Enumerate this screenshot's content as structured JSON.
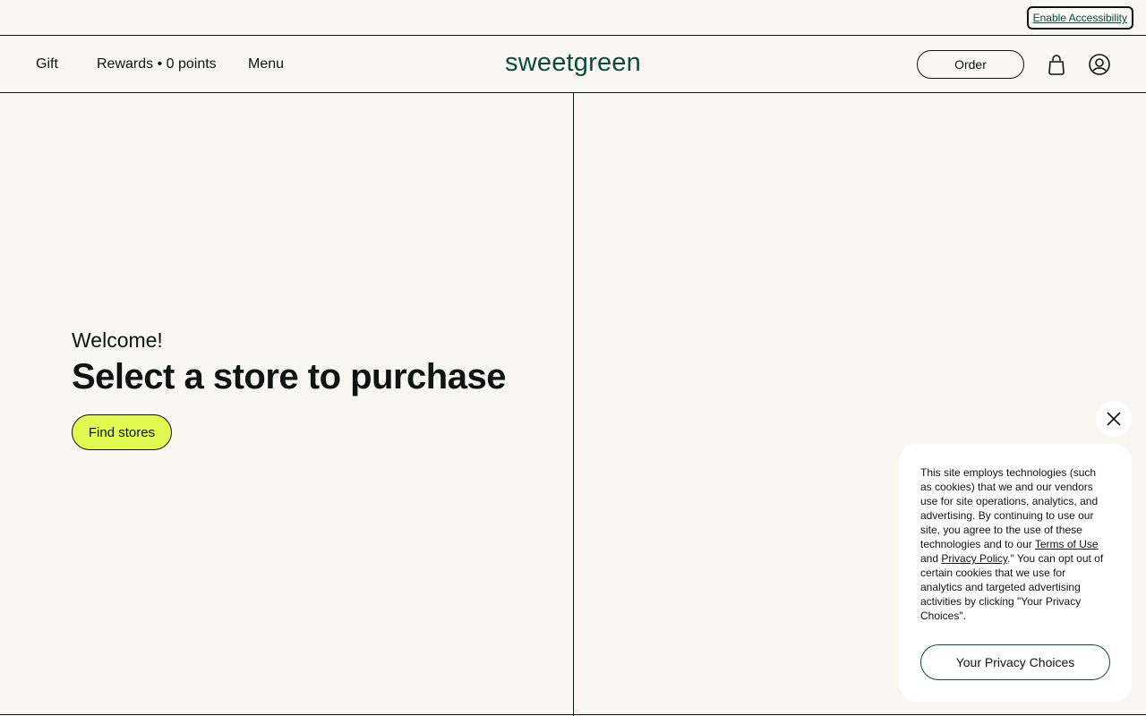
{
  "accessibility": {
    "label": "Enable Accessibility"
  },
  "nav": {
    "gift": "Gift",
    "rewards": "Rewards • 0 points",
    "menu": "Menu",
    "logo": "sweetgreen",
    "order": "Order",
    "bag_icon": "shopping-bag-icon",
    "account_icon": "account-icon"
  },
  "hero": {
    "welcome": "Welcome!",
    "headline": "Select a store to purchase",
    "find_stores": "Find stores"
  },
  "cookie": {
    "text_1": "This site employs technologies (such as cookies) that we and our vendors use for site operations, analytics, and advertising. By continuing to use our site, you agree to the use of these technologies and to our ",
    "terms_link": "Terms of Use",
    "text_2": " and ",
    "privacy_link": "Privacy Policy",
    "text_3": ".\" You can opt out of certain cookies that we use for analytics and targeted advertising activities by clicking \"Your Privacy Choices\".",
    "choices_button": "Your Privacy Choices",
    "close_icon": "close-icon"
  },
  "colors": {
    "background": "#f8f7f1",
    "brand_green": "#0e4a38",
    "accent_lime": "#e1fa50"
  }
}
